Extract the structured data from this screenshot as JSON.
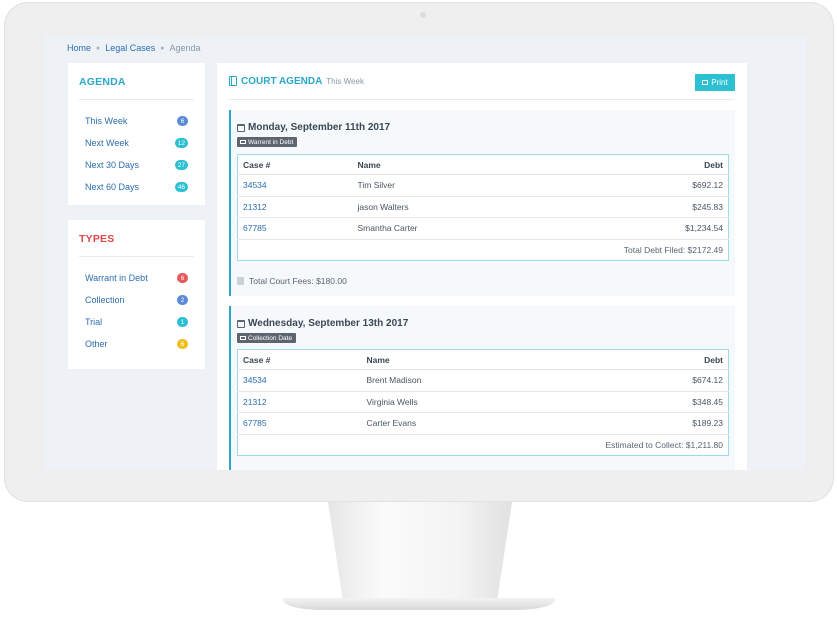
{
  "breadcrumb": {
    "home": "Home",
    "legal_cases": "Legal Cases",
    "current": "Agenda"
  },
  "agenda": {
    "title": "AGENDA",
    "items": [
      {
        "label": "This Week",
        "count": "6",
        "color": "#5b8ad6"
      },
      {
        "label": "Next Week",
        "count": "12",
        "color": "#2bc0d2"
      },
      {
        "label": "Next 30 Days",
        "count": "27",
        "color": "#2bc0d2"
      },
      {
        "label": "Next 60 Days",
        "count": "46",
        "color": "#2bc0d2"
      }
    ]
  },
  "types": {
    "title": "TYPES",
    "items": [
      {
        "label": "Warrant in Debt",
        "count": "6",
        "color": "#e8575c"
      },
      {
        "label": "Collection",
        "count": "2",
        "color": "#5b8ad6"
      },
      {
        "label": "Trial",
        "count": "1",
        "color": "#2bc0d2"
      },
      {
        "label": "Other",
        "count": "6",
        "color": "#f0be1e"
      }
    ]
  },
  "main": {
    "title": "COURT AGENDA",
    "subtitle": "This Week",
    "print_label": "Print",
    "days": [
      {
        "title": "Monday, September 11th 2017",
        "tag": "Warrent in Debt",
        "columns": [
          "Case #",
          "Name",
          "Debt"
        ],
        "rows": [
          {
            "case": "34534",
            "name": "Tim Silver",
            "debt": "$692.12"
          },
          {
            "case": "21312",
            "name": "jason Walters",
            "debt": "$245.83"
          },
          {
            "case": "67785",
            "name": "Smantha Carter",
            "debt": "$1,234.54"
          }
        ],
        "total": "Total Debt Filed: $2172.49",
        "fees": "Total Court Fees: $180.00"
      },
      {
        "title": "Wednesday, September 13th 2017",
        "tag": "Collection Date",
        "columns": [
          "Case #",
          "Name",
          "Debt"
        ],
        "rows": [
          {
            "case": "34534",
            "name": "Brent Madison",
            "debt": "$674.12"
          },
          {
            "case": "21312",
            "name": "Virginia Wells",
            "debt": "$348.45"
          },
          {
            "case": "67785",
            "name": "Carter Evans",
            "debt": "$189.23"
          }
        ],
        "total": "Estimated to Collect: $1,211.80"
      }
    ]
  },
  "colors": {
    "accent": "#2aa7c9",
    "types_title": "#e0454a",
    "link": "#2c6eaf"
  }
}
